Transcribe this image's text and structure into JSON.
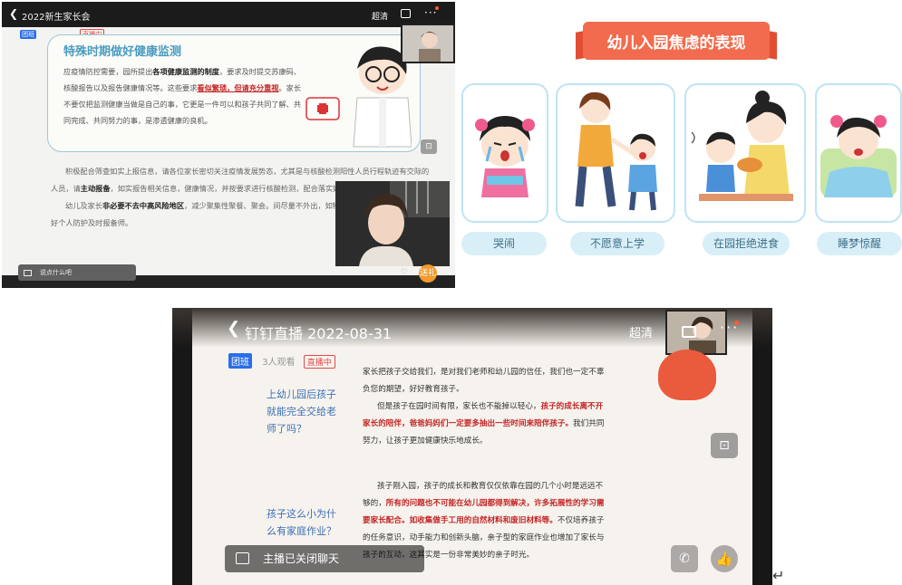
{
  "panel_top_left": {
    "header": {
      "back_icon": "chevron-left-icon",
      "title": "2022新生家长会",
      "quality": "超清",
      "more": "···"
    },
    "meta": {
      "tag": "团班",
      "live_status": "直播中"
    },
    "card": {
      "title": "特殊时期做好健康监测",
      "p1_a": "应疫情防控需要，园所提出",
      "p1_b": "各项健康监测的制度",
      "p1_c": "，要求及时提交苏康码、核酸报告以及报告健康情况等。这些要求",
      "p1_d": "看似繁琐，但请充分重视",
      "p1_e": "。家长不要仅把监测健康当做是自己的事，它更是一件可以和孩子共同了解、共同完成、共同努力的事，是渗透健康的良机。"
    },
    "body": {
      "p2_a": "积极配合筛查如实上报信息，请各位家长密切关注疫情发展势态，尤其是与核酸检测阳性人员行程轨迹有交际的人员，请",
      "p2_b": "主动报备",
      "p2_c": "，如实报告相关信息，健康情况，并按要求进行核酸检测，配合落实好管控措施。",
      "p3_a": "幼儿及家长",
      "p3_b": "非必要不去中高风险地区",
      "p3_c": "，减少聚集性聚餐、聚会。间尽量不外出，如特殊情况必须外出，请务必做好个人防护及时报备师。"
    },
    "chat_placeholder": "说点什么吧",
    "gift_label": "送礼"
  },
  "panel_top_right": {
    "banner_title": "幼儿入园焦虑的表现",
    "items": [
      {
        "label": "哭闹",
        "icon": "crying-girl-illustration"
      },
      {
        "label": "不愿意上学",
        "icon": "child-pulled-by-mother-illustration"
      },
      {
        "label": "在园拒绝进食",
        "icon": "refusing-food-illustration"
      },
      {
        "label": "睡梦惊醒",
        "icon": "waking-from-nightmare-illustration"
      }
    ]
  },
  "panel_bottom": {
    "header": {
      "back_icon": "chevron-left-icon",
      "title": "钉钉直播 2022-08-31",
      "quality": "超清",
      "more": "···"
    },
    "meta": {
      "tag": "团班",
      "views": "3人观看",
      "live_status": "直播中"
    },
    "q1": "上幼儿园后孩子就能完全交给老师了吗？",
    "a1_a": "家长把孩子交给我们，是对我们老师和幼儿园的信任，我们也一定不辜负您的期望，好好教育孩子。",
    "a1_b": "但是孩子在园时间有限，家长也不能掉以轻心，",
    "a1_c": "孩子的成长离不开家长的陪伴，爸爸妈妈们一定要多抽出一些时间来陪伴孩子。",
    "a1_d": "我们共同努力，让孩子更加健康快乐地成长。",
    "q2": "孩子这么小为什么有家庭作业？",
    "a2_a": "孩子刚入园，孩子的成长和教育仅仅依靠在园的几个小时是远远不够的，",
    "a2_b": "所有的问题也不可能在幼儿园都得到解决，许多拓展性的学习需要家长配合。如收集做手工用的自然材料和废旧材料等。",
    "a2_c": "不仅培养孩子的任务意识，动手能力和创新头脑，亲子型的家庭作业也增加了家长与孩子的互动，这其实是一份非常美妙的亲子时光。",
    "chat_closed": "主播已关闭聊天"
  },
  "colors": {
    "accent_blue": "#2b6ee8",
    "banner": "#f26b4e",
    "highlight_red": "#c42424",
    "frame_blue": "#bfe4f2"
  }
}
